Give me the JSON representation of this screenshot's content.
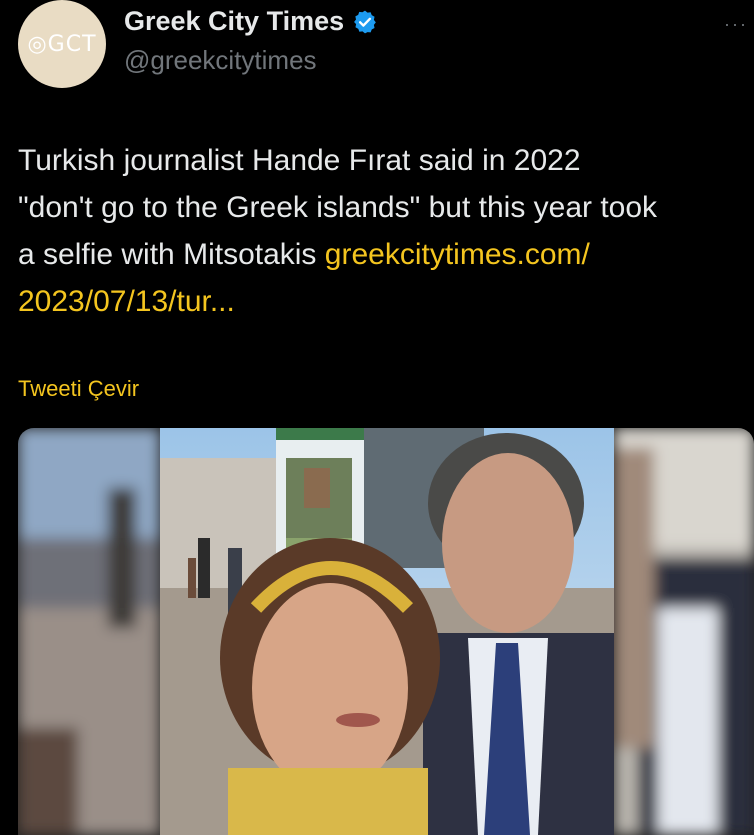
{
  "account": {
    "display_name": "Greek City Times",
    "handle": "@greekcitytimes",
    "avatar_text": "GCT",
    "verified_icon": "verified-badge-icon"
  },
  "tweet": {
    "line1": "Turkish journalist Hande Fırat said in 2022",
    "line2": "\"don't go to the Greek islands\" but this year took",
    "line3_text": "a selfie with Mitsotakis ",
    "line3_link": "greekcitytimes.com/",
    "line4_link": "2023/07/13/tur...",
    "translate_label": "Tweeti Çevir"
  },
  "colors": {
    "background": "#000000",
    "text": "#e7e9ea",
    "secondary": "#71767b",
    "accent": "#f4c51f",
    "verified": "#1d9bf0"
  },
  "menu": {
    "more_icon": "more-dots-icon",
    "more_label": "···"
  }
}
